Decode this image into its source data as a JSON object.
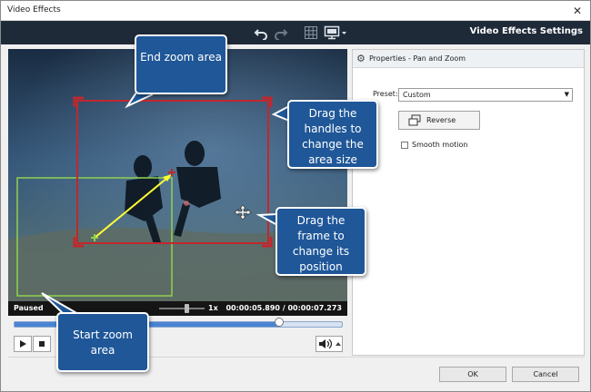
{
  "window": {
    "title": "Video Effects",
    "close_glyph": "✕"
  },
  "toolbar": {
    "settings_title": "Video Effects Settings",
    "icons": {
      "undo": "undo-icon",
      "redo": "redo-icon",
      "grid": "grid-icon",
      "monitor": "monitor-icon"
    }
  },
  "player": {
    "status": "Paused",
    "speed": "1x",
    "time": "00:00:05.890 / 00:00:07.273",
    "progress": 0.81
  },
  "properties": {
    "header": "Properties - Pan and Zoom",
    "preset_label": "Preset:",
    "preset_value": "Custom",
    "reverse_label": "Reverse",
    "smooth_motion_label": "Smooth motion",
    "smooth_motion_checked": false
  },
  "dialog": {
    "ok_label": "OK",
    "cancel_label": "Cancel"
  },
  "callouts": {
    "end_zoom": "End zoom area",
    "drag_handles": "Drag the handles to change the area size",
    "drag_frame": "Drag the frame to change its position",
    "start_zoom": "Start zoom area"
  },
  "colors": {
    "toolbar_bg": "#1f2a39",
    "callout_bg": "#1f5798",
    "end_frame": "#c0282d",
    "start_frame": "#8fd14f",
    "motion_arrow": "#ffff33",
    "seek_fill": "#4a84d4"
  }
}
